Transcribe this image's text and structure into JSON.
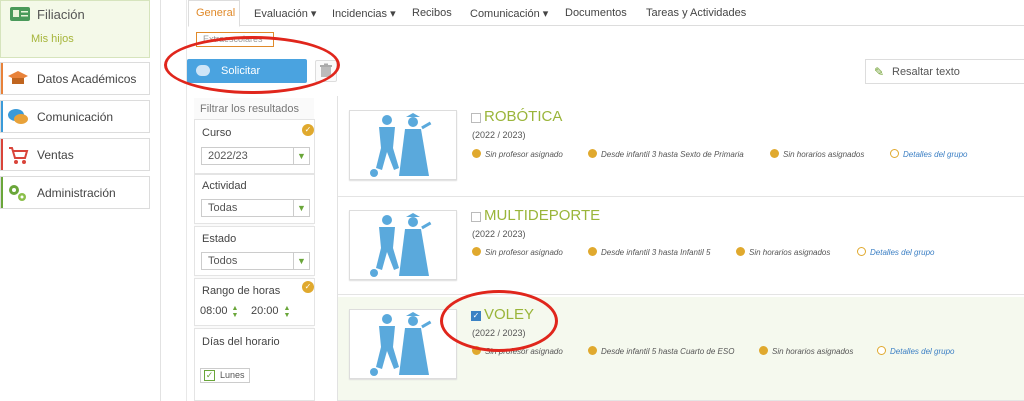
{
  "sidebar": {
    "header": {
      "label": "Filiación",
      "sub": "Mis hijos"
    },
    "items": [
      {
        "label": "Datos Académicos",
        "color": "#e8823a"
      },
      {
        "label": "Comunicación",
        "color": "#3a9ad9"
      },
      {
        "label": "Ventas",
        "color": "#d9443a"
      },
      {
        "label": "Administración",
        "color": "#6aa63a"
      }
    ]
  },
  "tabs": [
    {
      "label": "General"
    },
    {
      "label": "Evaluación ▾"
    },
    {
      "label": "Incidencias ▾"
    },
    {
      "label": "Recibos"
    },
    {
      "label": "Comunicación ▾"
    },
    {
      "label": "Documentos"
    },
    {
      "label": "Tareas y Actividades"
    }
  ],
  "subtab": "Extraescolares",
  "toolbar": {
    "solicitar": "Solicitar",
    "resaltar": "Resaltar texto"
  },
  "filters": {
    "title": "Filtrar los resultados",
    "curso": {
      "label": "Curso",
      "value": "2022/23"
    },
    "actividad": {
      "label": "Actividad",
      "value": "Todas"
    },
    "estado": {
      "label": "Estado",
      "value": "Todos"
    },
    "rango": {
      "label": "Rango de horas",
      "from": "08:00",
      "to": "20:00"
    },
    "dias": {
      "label": "Días del horario",
      "lunes": "Lunes"
    }
  },
  "activities": [
    {
      "title": "ROBÓTICA",
      "year": "(2022 / 2023)",
      "checked": false,
      "profesor": "Sin profesor asignado",
      "rango": "Desde infantil 3 hasta Sexto de Primaria",
      "horario": "Sin horarios asignados",
      "detalles": "Detalles del grupo"
    },
    {
      "title": "MULTIDEPORTE",
      "year": "(2022 / 2023)",
      "checked": false,
      "profesor": "Sin profesor asignado",
      "rango": "Desde infantil 3 hasta Infantil 5",
      "horario": "Sin horarios asignados",
      "detalles": "Detalles del grupo"
    },
    {
      "title": "VOLEY",
      "year": "(2022 / 2023)",
      "checked": true,
      "profesor": "Sin profesor asignado",
      "rango": "Desde infantil 5 hasta Cuarto de ESO",
      "horario": "Sin horarios asignados",
      "detalles": "Detalles del grupo"
    }
  ],
  "colors": {
    "accent_green": "#9ab53a",
    "button_blue": "#4aa3e0",
    "tab_orange": "#e08a2a",
    "annotation_red": "#e0261c"
  }
}
